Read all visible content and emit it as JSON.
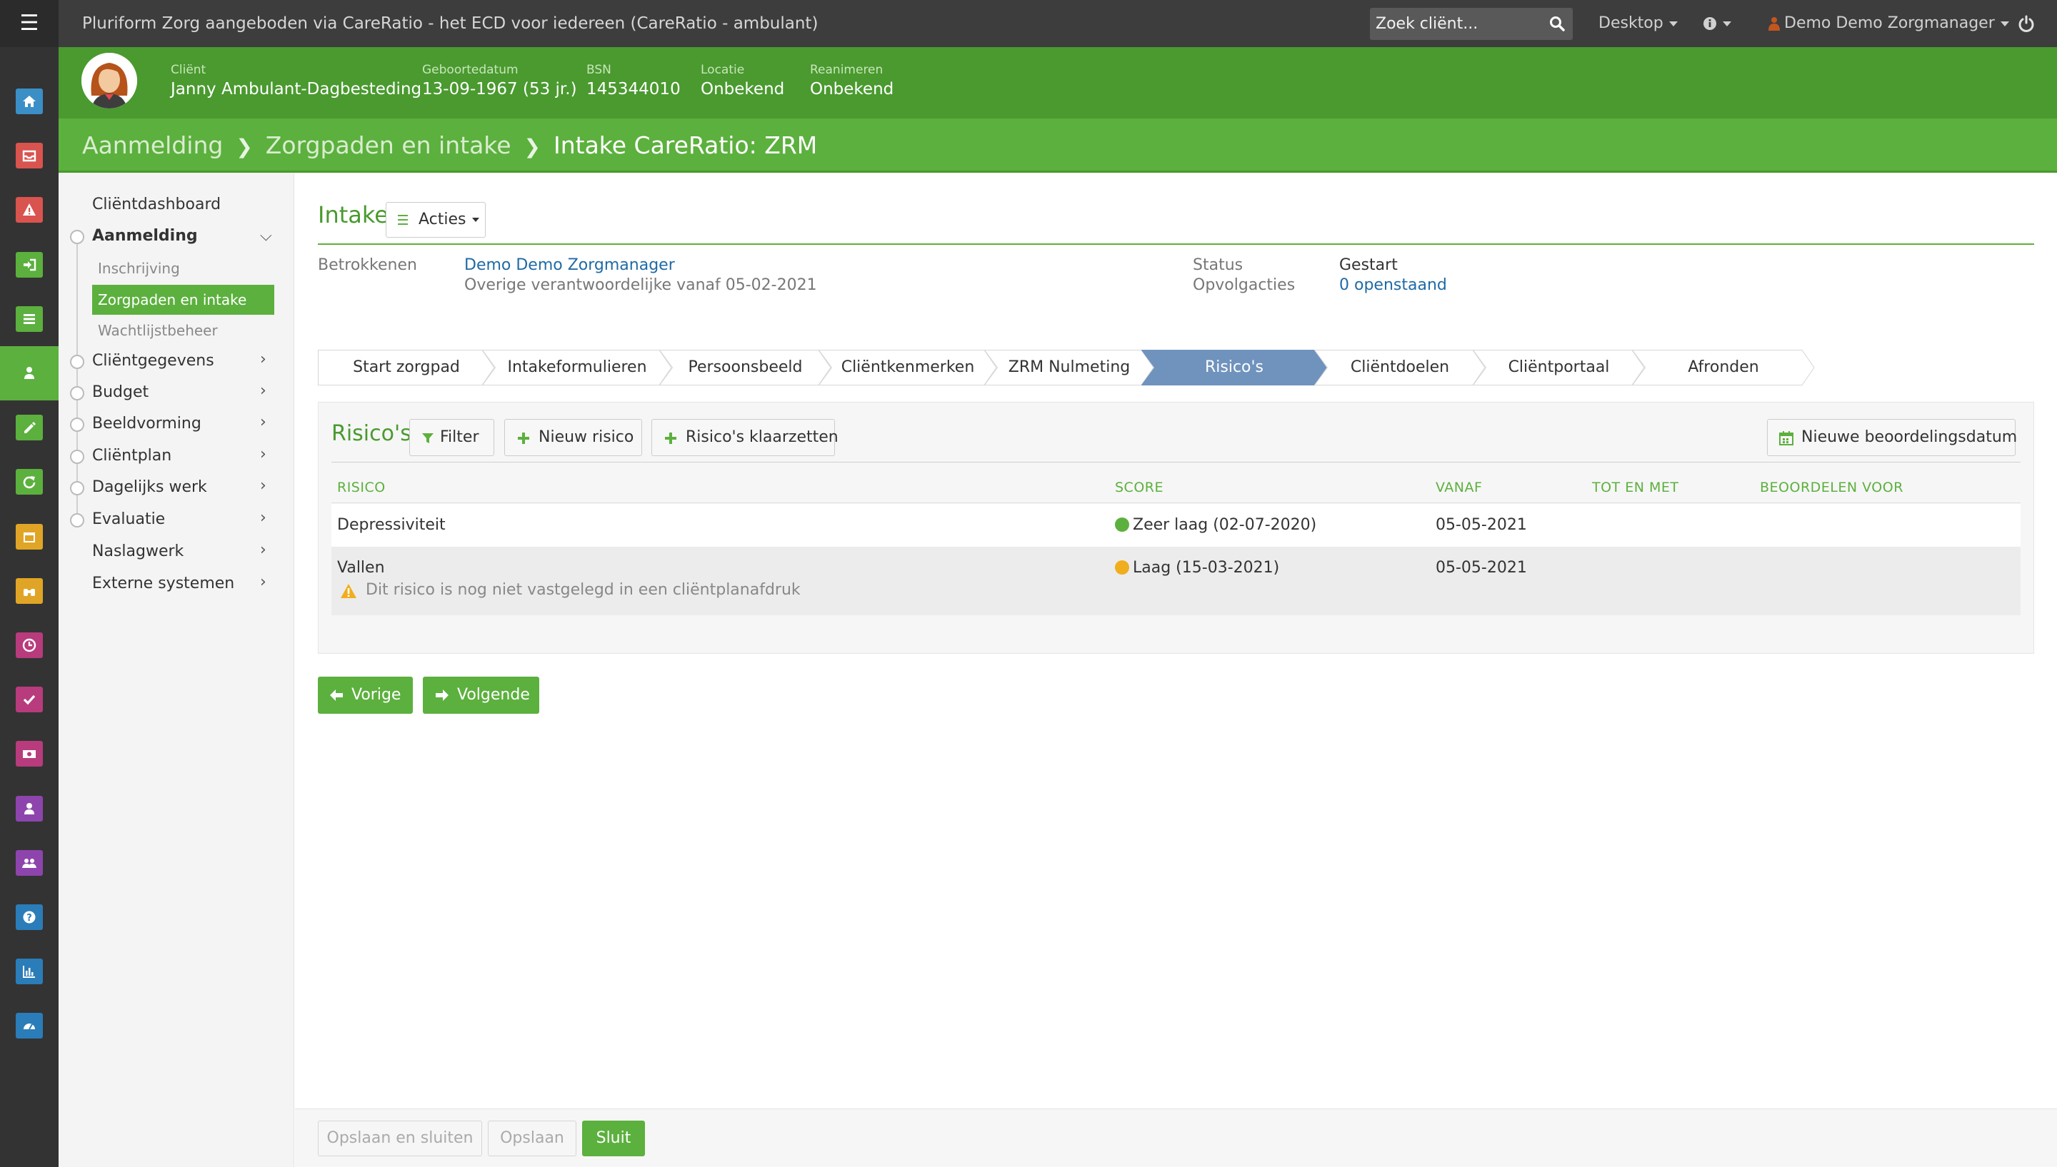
{
  "topbar": {
    "app_title": "Pluriform Zorg aangeboden via CareRatio - het ECD voor iedereen  (CareRatio - ambulant)",
    "search_placeholder": "Zoek cliënt...",
    "desktop_label": "Desktop",
    "user_label": "Demo Demo Zorgmanager"
  },
  "rail": {
    "icons": [
      "home-icon",
      "inbox-icon",
      "alert-icon",
      "login-icon",
      "list-icon",
      "client-icon",
      "pencil-icon",
      "refresh-icon",
      "calendar-icon",
      "binoculars-icon",
      "clock-icon",
      "check-icon",
      "money-icon",
      "user-icon",
      "group-icon",
      "help-icon",
      "chart-icon",
      "dashboard-icon"
    ],
    "colors": [
      "#3a8fc7",
      "#d9534f",
      "#d9534f",
      "#5cb03e",
      "#5cb03e",
      "#5cb03e",
      "#5cb03e",
      "#5cb03e",
      "#e0a526",
      "#e0a526",
      "#b83b7d",
      "#b83b7d",
      "#b83b7d",
      "#8e44ad",
      "#8e44ad",
      "#2a7db8",
      "#2a7db8",
      "#2a7db8"
    ]
  },
  "patient": {
    "client_label": "Cliënt",
    "client_name": "Janny Ambulant-Dagbesteding",
    "dob_label": "Geboortedatum",
    "dob": "13-09-1967 (53 jr.)",
    "bsn_label": "BSN",
    "bsn": "145344010",
    "locatie_label": "Locatie",
    "locatie": "Onbekend",
    "reanimeren_label": "Reanimeren",
    "reanimeren": "Onbekend"
  },
  "breadcrumb": {
    "items": [
      "Aanmelding",
      "Zorgpaden en intake",
      "Intake CareRatio: ZRM"
    ]
  },
  "subnav": {
    "clientdashboard": "Cliëntdashboard",
    "aanmelding": "Aanmelding",
    "inschrijving": "Inschrijving",
    "zorgpaden": "Zorgpaden en intake",
    "wachtlijst": "Wachtlijstbeheer",
    "clientgegevens": "Cliëntgegevens",
    "budget": "Budget",
    "beeldvorming": "Beeldvorming",
    "clientplan": "Cliëntplan",
    "dagelijks": "Dagelijks werk",
    "evaluatie": "Evaluatie",
    "naslagwerk": "Naslagwerk",
    "externe": "Externe systemen"
  },
  "intake": {
    "title": "Intake",
    "acties_label": "Acties",
    "betrokkenen_label": "Betrokkenen",
    "betrokkene_name": "Demo Demo Zorgmanager",
    "betrokkene_role": "Overige verantwoordelijke vanaf 05-02-2021",
    "status_label": "Status",
    "status_value": "Gestart",
    "opvolg_label": "Opvolgacties",
    "opvolg_value": "0 openstaand"
  },
  "steps": {
    "active_color": "#6f93bd",
    "items": [
      "Start zorgpad",
      "Intakeformulieren",
      "Persoonsbeeld",
      "Cliëntkenmerken",
      "ZRM Nulmeting",
      "Risico's",
      "Cliëntdoelen",
      "Cliëntportaal",
      "Afronden"
    ]
  },
  "risicos": {
    "title": "Risico's",
    "filter_label": "Filter",
    "nieuw_label": "Nieuw risico",
    "klaarzetten_label": "Risico's klaarzetten",
    "beoordeling_label": "Nieuwe beoordelingsdatum",
    "columns": [
      "RISICO",
      "SCORE",
      "VANAF",
      "TOT EN MET",
      "BEOORDELEN VOOR"
    ],
    "rows": [
      {
        "risico": "Depressiviteit",
        "score": "Zeer laag (02-07-2020)",
        "score_color": "#5cb03e",
        "vanaf": "05-05-2021",
        "tot": "",
        "beoordelen": "",
        "warning": ""
      },
      {
        "risico": "Vallen",
        "score": "Laag (15-03-2021)",
        "score_color": "#f0ad1e",
        "vanaf": "05-05-2021",
        "tot": "",
        "beoordelen": "",
        "warning": "Dit risico is nog niet vastgelegd in een cliëntplanafdruk"
      }
    ]
  },
  "nav_buttons": {
    "vorige": "Vorige",
    "volgende": "Volgende"
  },
  "footer": {
    "opslaan_sluiten": "Opslaan en sluiten",
    "opslaan": "Opslaan",
    "sluit": "Sluit"
  }
}
